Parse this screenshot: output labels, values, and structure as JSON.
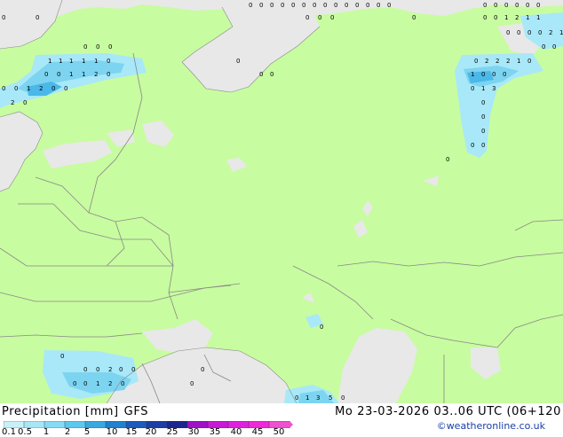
{
  "title": {
    "left_label": "Precipitation [mm]",
    "model": "GFS",
    "right_label": "Mo 23-03-2026 03..06 UTC (06+120"
  },
  "credit": "©weatheronline.co.uk",
  "legend": {
    "ticks": [
      "0.1",
      "0.5",
      "1",
      "2",
      "5",
      "10",
      "15",
      "20",
      "25",
      "30",
      "35",
      "40",
      "45",
      "50"
    ],
    "colors": [
      "#c8f0f8",
      "#a6e6f6",
      "#84dbf4",
      "#5cc8ee",
      "#37a9e0",
      "#1f81cf",
      "#1a5bbd",
      "#1c3ea6",
      "#1b2690",
      "#a010c8",
      "#c818d8",
      "#e020e0",
      "#f028d8",
      "#f050d0"
    ]
  },
  "colors": {
    "land": "#c8fca0",
    "sea": "#e8e8e8",
    "precip_light": "#a8e8f8",
    "precip_medium": "#7cd4f0",
    "precip_heavy": "#4ab8e8",
    "border": "#888888"
  },
  "cell_labels": [
    [
      "0",
      "0",
      "0",
      "0",
      "0",
      "0",
      "0",
      "0",
      "0",
      "0",
      "0",
      "0",
      "0",
      "0",
      "0",
      "0",
      "0",
      "0",
      "0",
      "0"
    ],
    [
      "0",
      "0",
      "0",
      "0",
      "0",
      "0"
    ],
    [
      "0",
      "0",
      "1",
      "2",
      "1",
      "1",
      "0",
      "0",
      "0",
      "0",
      "2",
      "1"
    ],
    [
      "0",
      "0",
      "0",
      "0",
      "0",
      "1",
      "1",
      "1",
      "1",
      "1",
      "0"
    ],
    [
      "0",
      "2",
      "2",
      "2",
      "1",
      "0",
      "0",
      "0",
      "1",
      "1",
      "2",
      "0"
    ],
    [
      "0",
      "0",
      "1",
      "2",
      "0",
      "0",
      "1",
      "0",
      "0",
      "0",
      "0",
      "0",
      "0"
    ],
    [
      "0",
      "1",
      "3",
      "2",
      "0",
      "0",
      "0",
      "0",
      "0",
      "0",
      "0",
      "0"
    ],
    [
      "0",
      "0",
      "0",
      "2",
      "0",
      "0",
      "0",
      "0",
      "1",
      "2",
      "0",
      "0",
      "0",
      "0",
      "1",
      "3",
      "5",
      "0"
    ]
  ]
}
